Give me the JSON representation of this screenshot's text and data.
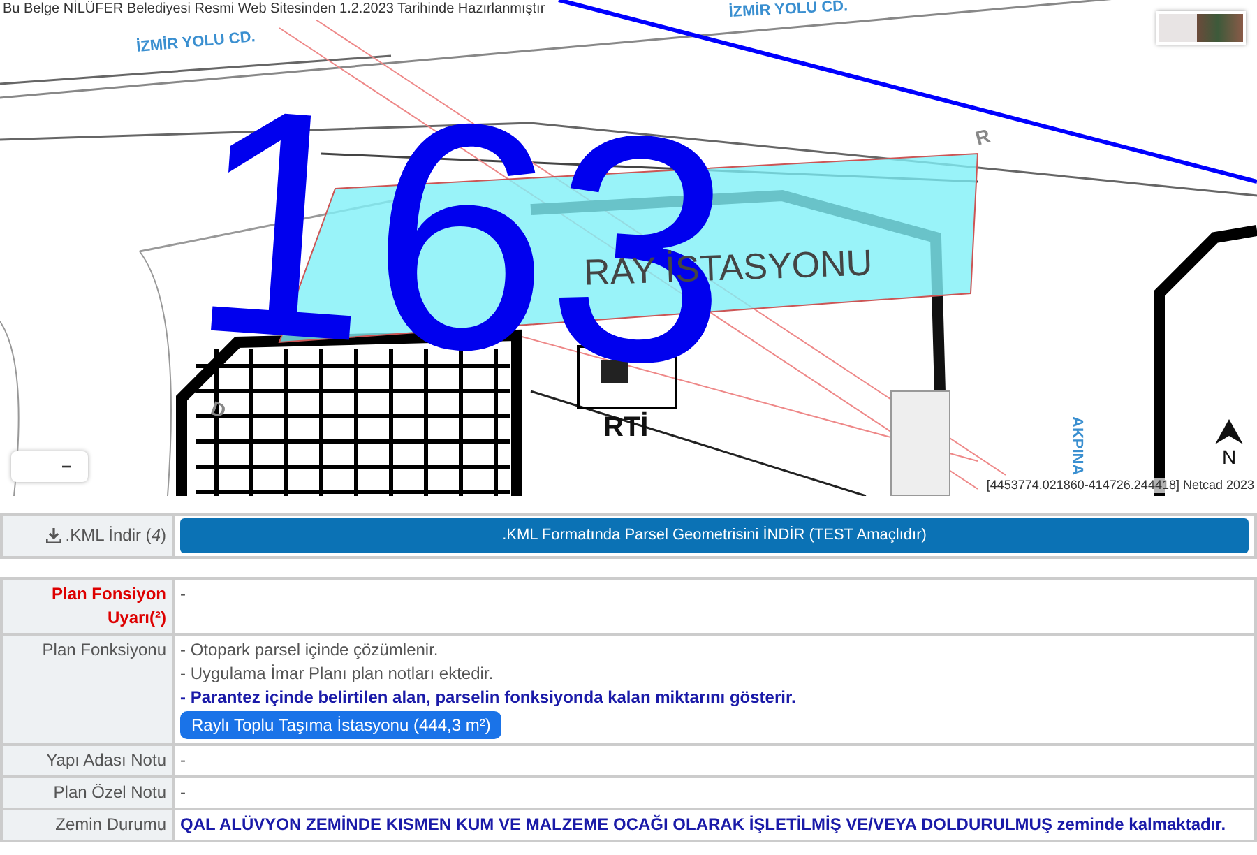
{
  "map": {
    "notice": "Bu Belge NİLÜFER Belediyesi Resmi Web Sitesinden 1.2.2023 Tarihinde Hazırlanmıştır",
    "street_labels": [
      {
        "text": "İZMİR YOLU CD.",
        "kind": "left"
      },
      {
        "text": "İZMİR YOLU CD.",
        "kind": "top"
      },
      {
        "text": "AKPINA",
        "kind": "vertical"
      }
    ],
    "street_letters": [
      "R",
      "D"
    ],
    "parcel_number": "163",
    "station_label": "RAY İSTASYONU",
    "symbol_label": "RTİ",
    "zoom_out": "−",
    "north": "N",
    "coordinates": "[4453774.021860-414726.244418] Netcad 2023"
  },
  "kml": {
    "label": ".KML İndir (*4*)",
    "button": ".KML Formatında Parsel Geometrisini İNDİR (TEST Amaçlıdır)"
  },
  "rows": [
    {
      "label": "Plan Fonsiyon Uyarı(²)",
      "warning": true,
      "lines": [
        {
          "text": "-",
          "kind": "plain"
        }
      ]
    },
    {
      "label": "Plan Fonksiyonu",
      "warning": false,
      "lines": [
        {
          "text": "- Otopark parsel içinde çözümlenir.",
          "kind": "plain"
        },
        {
          "text": "- Uygulama İmar Planı plan notları ektedir.",
          "kind": "plain"
        },
        {
          "text": "- Parantez içinde belirtilen alan, parselin fonksiyonda kalan miktarını gösterir.",
          "kind": "emphasis"
        },
        {
          "text": "Raylı Toplu Taşıma İstasyonu (444,3 m²)",
          "kind": "button"
        }
      ]
    },
    {
      "label": "Yapı Adası Notu",
      "warning": false,
      "lines": [
        {
          "text": "-",
          "kind": "plain"
        }
      ]
    },
    {
      "label": "Plan Özel Notu",
      "warning": false,
      "lines": [
        {
          "text": "-",
          "kind": "plain"
        }
      ]
    },
    {
      "label": "Zemin Durumu",
      "warning": false,
      "lines": [
        {
          "text": "QAL ALÜVYON ZEMİNDE KISMEN KUM VE MALZEME OCAĞI OLARAK İŞLETİLMİŞ VE/VEYA DOLDURULMUŞ zeminde kalmaktadır.",
          "kind": "emphasis"
        }
      ]
    }
  ]
}
